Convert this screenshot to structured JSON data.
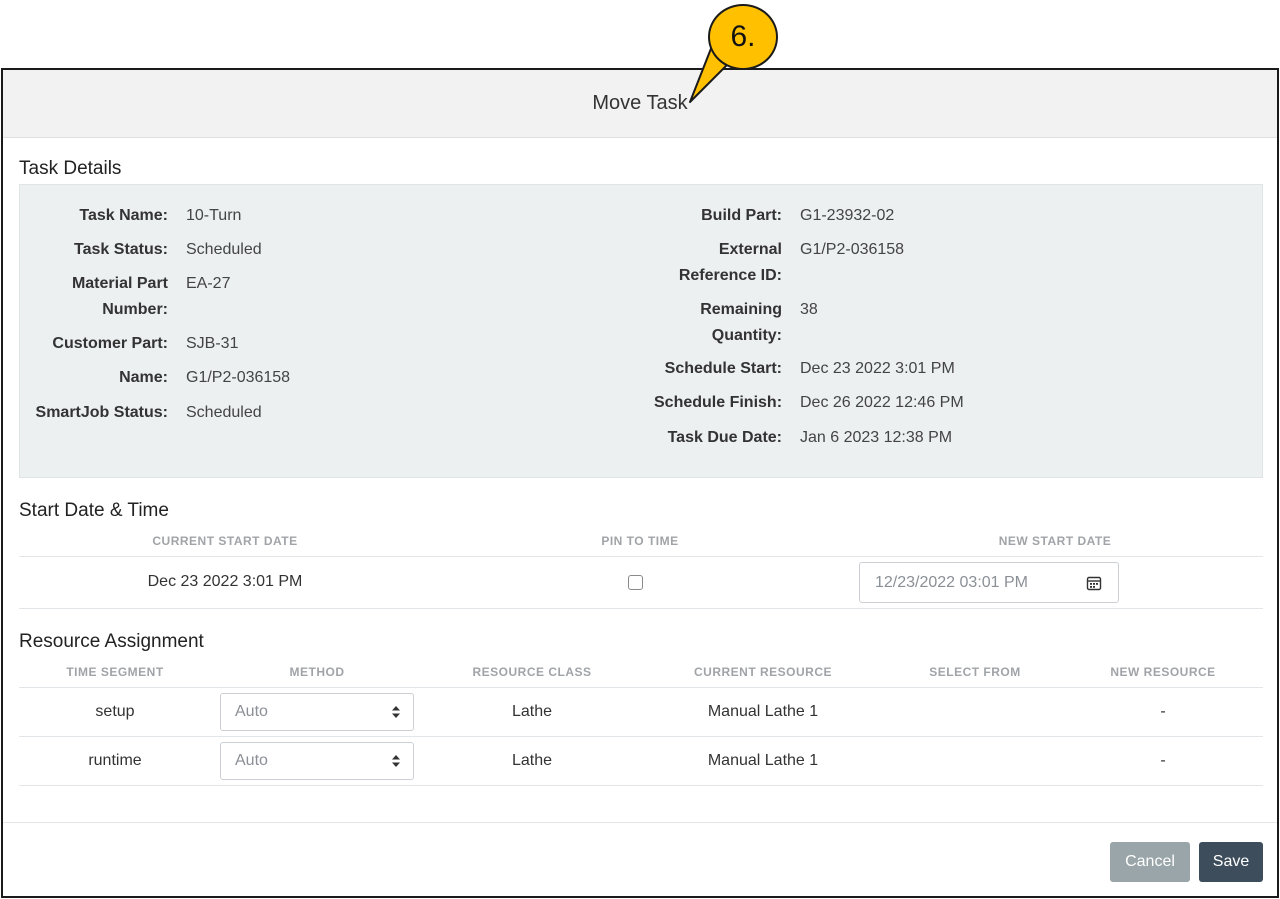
{
  "callout": {
    "label": "6."
  },
  "modal": {
    "title": "Move Task"
  },
  "task_details": {
    "heading": "Task Details",
    "left": [
      {
        "label": "Task Name:",
        "value": "10-Turn"
      },
      {
        "label": "Task Status:",
        "value": "Scheduled"
      },
      {
        "label_line1": "Material Part",
        "label_line2": "Number:",
        "value": "EA-27"
      },
      {
        "label": "Customer Part:",
        "value": "SJB-31"
      },
      {
        "label": "Name:",
        "value": "G1/P2-036158"
      },
      {
        "label": "SmartJob Status:",
        "value": "Scheduled"
      }
    ],
    "right": [
      {
        "label": "Build Part:",
        "value": "G1-23932-02"
      },
      {
        "label_line1": "External",
        "label_line2": "Reference ID:",
        "value": "G1/P2-036158"
      },
      {
        "label_line1": "Remaining",
        "label_line2": "Quantity:",
        "value": "38"
      },
      {
        "label": "Schedule Start:",
        "value": "Dec 23 2022 3:01 PM"
      },
      {
        "label": "Schedule Finish:",
        "value": "Dec 26 2022 12:46 PM"
      },
      {
        "label": "Task Due Date:",
        "value": "Jan 6 2023 12:38 PM"
      }
    ]
  },
  "start_date": {
    "heading": "Start Date & Time",
    "columns": [
      "CURRENT START DATE",
      "PIN TO TIME",
      "NEW START DATE"
    ],
    "current_start": "Dec 23 2022 3:01 PM",
    "pin_to_time": false,
    "new_start_value": "12/23/2022 03:01 PM"
  },
  "resource": {
    "heading": "Resource Assignment",
    "columns": [
      "TIME SEGMENT",
      "METHOD",
      "RESOURCE CLASS",
      "CURRENT RESOURCE",
      "SELECT FROM",
      "NEW RESOURCE"
    ],
    "rows": [
      {
        "segment": "setup",
        "method": "Auto",
        "resource_class": "Lathe",
        "current_resource": "Manual Lathe 1",
        "select_from": "",
        "new_resource": "-"
      },
      {
        "segment": "runtime",
        "method": "Auto",
        "resource_class": "Lathe",
        "current_resource": "Manual Lathe 1",
        "select_from": "",
        "new_resource": "-"
      }
    ]
  },
  "footer": {
    "cancel_label": "Cancel",
    "save_label": "Save"
  },
  "colors": {
    "callout": "#ffc000",
    "save": "#3d4d5c",
    "cancel": "#99a5a8",
    "details_bg": "#ecf0f1"
  }
}
